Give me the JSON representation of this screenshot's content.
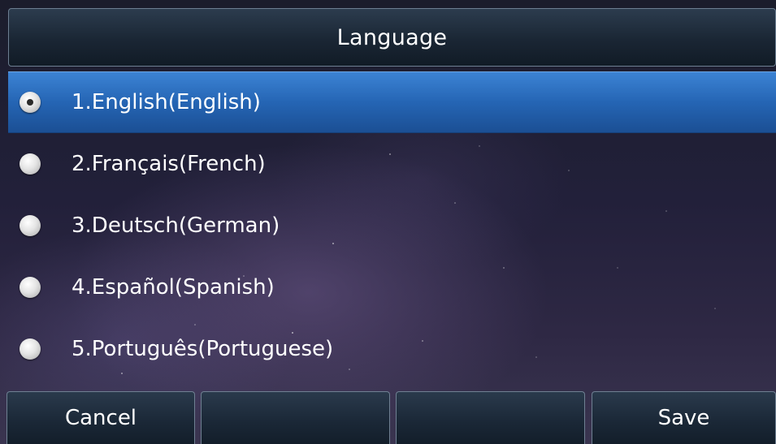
{
  "header": {
    "title": "Language"
  },
  "languages": [
    {
      "label": "1.English(English)",
      "selected": true
    },
    {
      "label": "2.Français(French)",
      "selected": false
    },
    {
      "label": "3.Deutsch(German)",
      "selected": false
    },
    {
      "label": "4.Español(Spanish)",
      "selected": false
    },
    {
      "label": "5.Português(Portuguese)",
      "selected": false
    }
  ],
  "softkeys": {
    "key1": "Cancel",
    "key2": "",
    "key3": "",
    "key4": "Save"
  },
  "colors": {
    "selection": "#2a6bbd",
    "text": "#ffffff"
  }
}
